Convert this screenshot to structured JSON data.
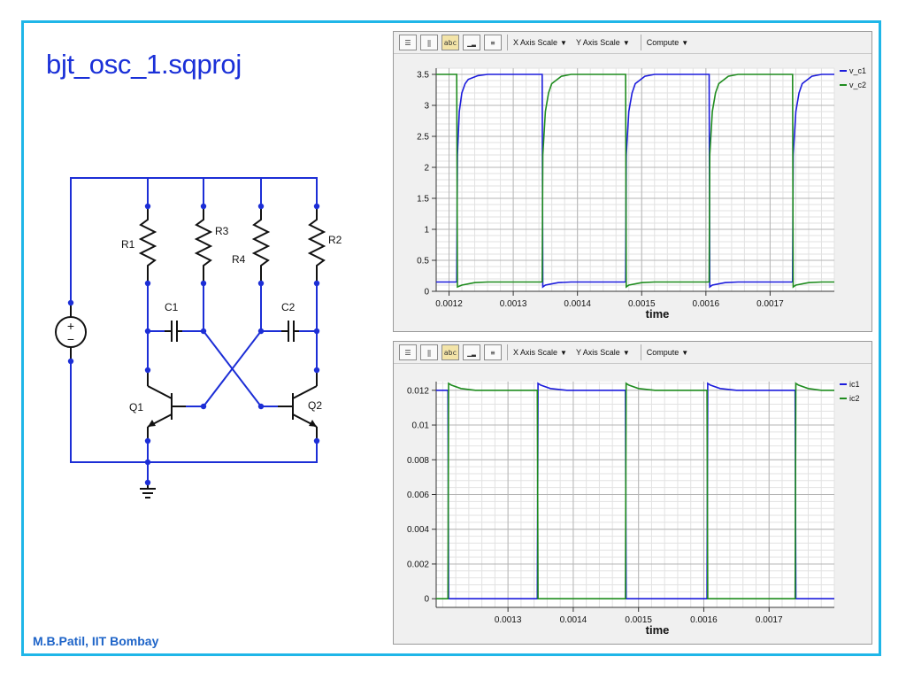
{
  "slide": {
    "title": "bjt_osc_1.sqproj",
    "credit": "M.B.Patil, IIT Bombay"
  },
  "schematic": {
    "components": [
      "R1",
      "R3",
      "R4",
      "R2",
      "C1",
      "C2",
      "Q1",
      "Q2"
    ],
    "wire_color": "#1c2ed6"
  },
  "plots": [
    {
      "toolbar": {
        "x_menu": "X Axis Scale",
        "y_menu": "Y Axis Scale",
        "compute_menu": "Compute"
      },
      "xlabel": "time"
    },
    {
      "toolbar": {
        "x_menu": "X Axis Scale",
        "y_menu": "Y Axis Scale",
        "compute_menu": "Compute"
      },
      "xlabel": "time"
    }
  ],
  "chart_data": [
    {
      "type": "line",
      "xlabel": "time",
      "ylabel": "",
      "xlim": [
        0.00118,
        0.0018
      ],
      "ylim": [
        0,
        3.6
      ],
      "xticks": [
        0.0012,
        0.0013,
        0.0014,
        0.0015,
        0.0016,
        0.0017
      ],
      "xtick_labels": [
        "0.0012",
        "0.0013",
        "0.0014",
        "0.0015",
        "0.0016",
        "0.0017"
      ],
      "yticks": [
        0,
        0.5,
        1,
        1.5,
        2,
        2.5,
        3,
        3.5
      ],
      "ytick_labels": [
        "0",
        "0.5",
        "1",
        "1.5",
        "2",
        "2.5",
        "3",
        "3.5"
      ],
      "grid": true,
      "legend": "right",
      "series": [
        {
          "name": "v_c1",
          "color": "#1c1cdc",
          "x": [
            0.00118,
            0.001212,
            0.001213,
            0.001216,
            0.00122,
            0.001225,
            0.00123,
            0.001245,
            0.00126,
            0.001345,
            0.001346,
            0.00135,
            0.00137,
            0.00139,
            0.001475,
            0.001476,
            0.00148,
            0.001485,
            0.00149,
            0.001505,
            0.00152,
            0.001605,
            0.001606,
            0.00161,
            0.00163,
            0.00165,
            0.001735,
            0.001736,
            0.00174,
            0.001745,
            0.00175,
            0.001765,
            0.00178,
            0.0018
          ],
          "y": [
            0.15,
            0.15,
            2.2,
            2.9,
            3.2,
            3.35,
            3.42,
            3.48,
            3.5,
            3.5,
            0.07,
            0.1,
            0.14,
            0.15,
            0.15,
            2.2,
            2.9,
            3.2,
            3.35,
            3.47,
            3.5,
            3.5,
            0.07,
            0.1,
            0.14,
            0.15,
            0.15,
            2.2,
            2.9,
            3.2,
            3.35,
            3.47,
            3.5,
            3.5
          ]
        },
        {
          "name": "v_c2",
          "color": "#1f8c1f",
          "x": [
            0.00118,
            0.001212,
            0.001213,
            0.00122,
            0.00124,
            0.00126,
            0.001345,
            0.001346,
            0.00135,
            0.001355,
            0.00136,
            0.001375,
            0.00139,
            0.001475,
            0.001476,
            0.00148,
            0.0015,
            0.00152,
            0.001605,
            0.001606,
            0.00161,
            0.001615,
            0.00162,
            0.001635,
            0.00165,
            0.001735,
            0.001736,
            0.00174,
            0.00176,
            0.00178,
            0.0018
          ],
          "y": [
            3.5,
            3.5,
            0.07,
            0.1,
            0.14,
            0.15,
            0.15,
            2.2,
            2.9,
            3.2,
            3.35,
            3.47,
            3.5,
            3.5,
            0.07,
            0.1,
            0.14,
            0.15,
            0.15,
            2.2,
            2.9,
            3.2,
            3.35,
            3.47,
            3.5,
            3.5,
            0.07,
            0.1,
            0.14,
            0.15,
            0.15
          ]
        }
      ]
    },
    {
      "type": "line",
      "xlabel": "time",
      "ylabel": "",
      "xlim": [
        0.00119,
        0.0018
      ],
      "ylim": [
        -0.0005,
        0.0125
      ],
      "xticks": [
        0.0013,
        0.0014,
        0.0015,
        0.0016,
        0.0017
      ],
      "xtick_labels": [
        "0.0013",
        "0.0014",
        "0.0015",
        "0.0016",
        "0.0017"
      ],
      "yticks": [
        0,
        0.002,
        0.004,
        0.006,
        0.008,
        0.01,
        0.012
      ],
      "ytick_labels": [
        "0",
        "0.002",
        "0.004",
        "0.006",
        "0.008",
        "0.01",
        "0.012"
      ],
      "grid": true,
      "legend": "right",
      "series": [
        {
          "name": "ic1",
          "color": "#1c1cdc",
          "x": [
            0.00119,
            0.001208,
            0.001209,
            0.001345,
            0.001346,
            0.00135,
            0.001365,
            0.00139,
            0.00147,
            0.00148,
            0.001481,
            0.001605,
            0.001606,
            0.00161,
            0.001625,
            0.00165,
            0.00173,
            0.00174,
            0.001741,
            0.0018
          ],
          "y": [
            0.012,
            0.012,
            0,
            0,
            0.0124,
            0.0123,
            0.0121,
            0.012,
            0.012,
            0.012,
            0,
            0,
            0.0124,
            0.0123,
            0.0121,
            0.012,
            0.012,
            0.012,
            0,
            0
          ]
        },
        {
          "name": "ic2",
          "color": "#1f8c1f",
          "x": [
            0.00119,
            0.001208,
            0.001209,
            0.001213,
            0.001228,
            0.00125,
            0.00134,
            0.001345,
            0.001346,
            0.00148,
            0.001481,
            0.001485,
            0.0015,
            0.001525,
            0.0016,
            0.001605,
            0.001606,
            0.00174,
            0.001741,
            0.001745,
            0.00176,
            0.00178,
            0.0018
          ],
          "y": [
            0,
            0,
            0.0124,
            0.0123,
            0.0121,
            0.012,
            0.012,
            0.012,
            0,
            0,
            0.0124,
            0.0123,
            0.0121,
            0.012,
            0.012,
            0.012,
            0,
            0,
            0.0124,
            0.0123,
            0.0121,
            0.012,
            0.012
          ]
        }
      ]
    }
  ]
}
